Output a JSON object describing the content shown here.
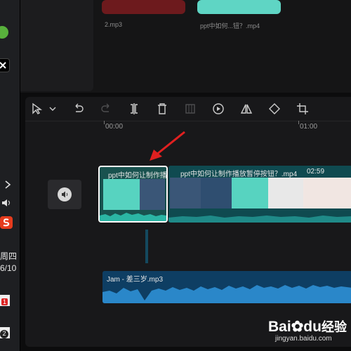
{
  "library": {
    "items": [
      {
        "label": "2.mp3",
        "color": "#6d1a1d"
      },
      {
        "label": "ppt中如何...钮？.mp4",
        "color": "#5fd5c4"
      }
    ]
  },
  "taskbar": {
    "time_line1": "周四",
    "time_line2": "6/10",
    "badge_count": "1",
    "badge2": "2",
    "icons": [
      "browser-icon",
      "capcut-icon",
      "chevron-right-icon",
      "speaker-icon",
      "sogou-icon"
    ]
  },
  "toolbar": {
    "tools": [
      "select-tool-icon",
      "undo-icon",
      "redo-icon",
      "split-icon",
      "delete-icon",
      "freeze-icon",
      "play-circle-icon",
      "mirror-icon",
      "rotate-icon",
      "crop-icon"
    ]
  },
  "ruler": {
    "ticks": [
      "00:00",
      "01:00"
    ]
  },
  "clips": {
    "video1_title": "ppt中如何让制作播放",
    "video2_title": "ppt中如何让制作播放暂停按钮？.mp4",
    "video2_duration": "02:59",
    "audio_title": "Jam - 差三岁.mp3"
  },
  "watermark": {
    "brand": "Bai",
    "brand2": "du",
    "suffix": "经验",
    "url": "jingyan.baidu.com"
  },
  "colors": {
    "arrow": "#e02020",
    "selection": "#ffffff",
    "video_clip": "#0f4a50",
    "audio_clip": "#0e3e63"
  }
}
